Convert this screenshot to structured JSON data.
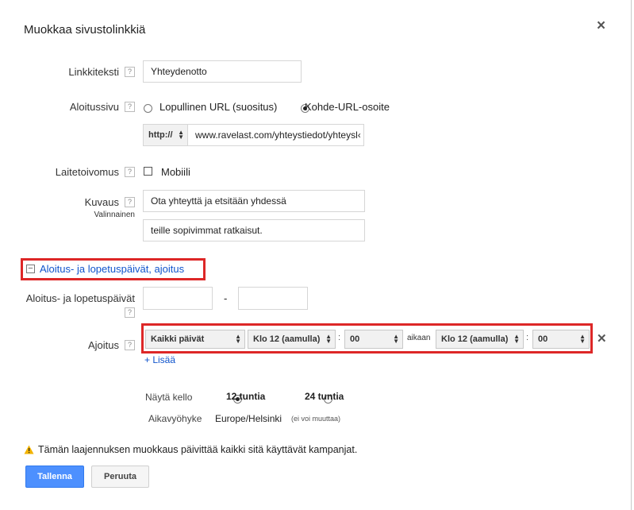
{
  "dialog": {
    "title": "Muokkaa sivustolinkkiä",
    "close": "×"
  },
  "help_glyph": "?",
  "link_text": {
    "label": "Linkkiteksti",
    "value": "Yhteydenotto"
  },
  "landing": {
    "label": "Aloitussivu",
    "option_final_url": "Lopullinen URL (suositus)",
    "option_destination_url": "Kohde-URL-osoite",
    "selected": "Kohde-URL-osoite",
    "protocol": "http://",
    "url": "www.ravelast.com/yhteystiedot/yhteysl‹"
  },
  "device": {
    "label": "Laitetoivomus",
    "option": "Mobiili",
    "checked": false
  },
  "description": {
    "label": "Kuvaus",
    "sublabel": "Valinnainen",
    "line1": "Ota yhteyttä ja etsitään yhdessä",
    "line2": "teille sopivimmat ratkaisut."
  },
  "section": {
    "toggle_glyph": "−",
    "title": "Aloitus- ja lopetuspäivät, ajoitus"
  },
  "dates": {
    "label": "Aloitus- ja lopetuspäivät",
    "separator": "-",
    "start": "",
    "end": ""
  },
  "schedule": {
    "label": "Ajoitus",
    "day": "Kaikki päivät",
    "from_hour": "Klo 12 (aamulla)",
    "colon": ":",
    "from_minute": "00",
    "until": "aikaan",
    "to_hour": "Klo 12 (aamulla)",
    "to_minute": "00",
    "remove": "✕",
    "add": "+ Lisää"
  },
  "clock": {
    "label": "Näytä kello",
    "option_12": "12 tuntia",
    "option_24": "24 tuntia",
    "selected": "12 tuntia"
  },
  "timezone": {
    "label": "Aikavyöhyke",
    "value": "Europe/Helsinki",
    "note": "(ei voi muuttaa)"
  },
  "warning": {
    "icon": "warning-icon",
    "text": "Tämän laajennuksen muokkaus päivittää kaikki sitä käyttävät kampanjat."
  },
  "buttons": {
    "save": "Tallenna",
    "cancel": "Peruuta"
  },
  "colors": {
    "highlight": "#dd2727",
    "primary": "#4d90fe",
    "link": "#1155cc"
  }
}
